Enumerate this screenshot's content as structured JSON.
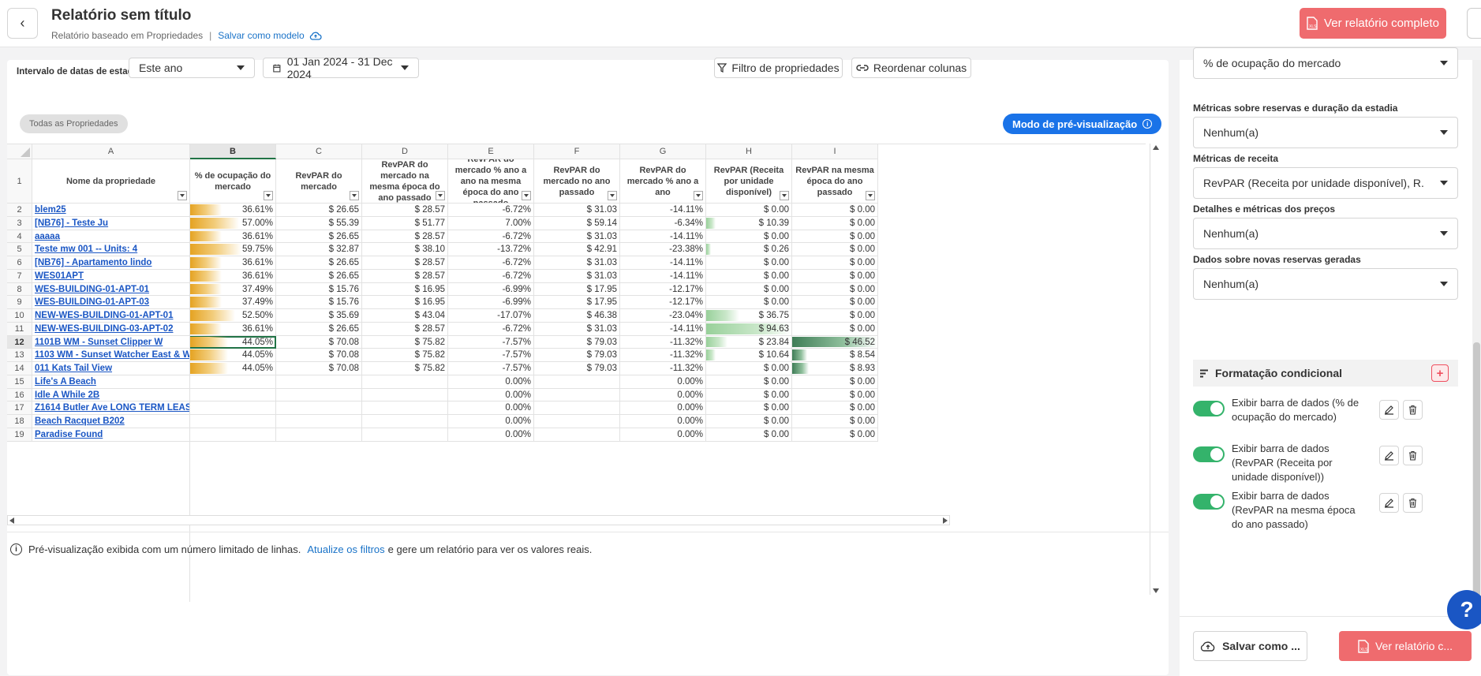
{
  "header": {
    "title": "Relatório sem título",
    "subtitle": "Relatório baseado em Propriedades",
    "separator": "|",
    "save_template": "Salvar como modelo",
    "full_report_button": "Ver relatório completo",
    "icons": {
      "back": "chevron-left-icon",
      "cloud": "cloud-upload-icon",
      "file": "xls-file-icon",
      "help": "help-icon"
    }
  },
  "filters": {
    "date_range_label": "Intervalo de datas de estadia",
    "period_value": "Este ano",
    "date_value": "01 Jan 2024 - 31 Dec 2024",
    "properties_filter_button": "Filtro de propriedades",
    "reorder_columns_button": "Reordenar colunas",
    "all_properties_chip": "Todas as Propriedades",
    "preview_mode_badge": "Modo de pré-visualização"
  },
  "grid": {
    "column_letters": [
      "A",
      "B",
      "C",
      "D",
      "E",
      "F",
      "G",
      "H",
      "I"
    ],
    "selected_column": "B",
    "selected_row": 12,
    "header_row_number": "1",
    "headers": [
      "Nome da propriedade",
      "% de ocupação do mercado",
      "RevPAR do mercado",
      "RevPAR do mercado na mesma época do ano passado",
      "RevPAR do mercado % ano a ano na mesma época do ano passado",
      "RevPAR do mercado no ano passado",
      "RevPAR do mercado % ano a ano",
      "RevPAR (Receita por unidade disponível)",
      "RevPAR na mesma época do ano passado"
    ],
    "rows": [
      {
        "n": "2",
        "name": "blem25",
        "occ": "36.61%",
        "occ_v": 36.61,
        "c": "$ 26.65",
        "d": "$ 28.57",
        "e": "-6.72%",
        "f": "$ 31.03",
        "g": "-14.11%",
        "h": "$ 0.00",
        "h_v": 0,
        "i": "$ 0.00",
        "i_v": 0
      },
      {
        "n": "3",
        "name": "[NB76] - Teste Ju",
        "occ": "57.00%",
        "occ_v": 57.0,
        "c": "$ 55.39",
        "d": "$ 51.77",
        "e": "7.00%",
        "f": "$ 59.14",
        "g": "-6.34%",
        "h": "$ 10.39",
        "h_v": 10.39,
        "i": "$ 0.00",
        "i_v": 0
      },
      {
        "n": "4",
        "name": "aaaaa",
        "occ": "36.61%",
        "occ_v": 36.61,
        "c": "$ 26.65",
        "d": "$ 28.57",
        "e": "-6.72%",
        "f": "$ 31.03",
        "g": "-14.11%",
        "h": "$ 0.00",
        "h_v": 0,
        "i": "$ 0.00",
        "i_v": 0
      },
      {
        "n": "5",
        "name": "Teste mw 001 -- Units: 4",
        "occ": "59.75%",
        "occ_v": 59.75,
        "c": "$ 32.87",
        "d": "$ 38.10",
        "e": "-13.72%",
        "f": "$ 42.91",
        "g": "-23.38%",
        "h": "$ 0.26",
        "h_v": 0.26,
        "i": "$ 0.00",
        "i_v": 0
      },
      {
        "n": "6",
        "name": "[NB76] - Apartamento lindo",
        "occ": "36.61%",
        "occ_v": 36.61,
        "c": "$ 26.65",
        "d": "$ 28.57",
        "e": "-6.72%",
        "f": "$ 31.03",
        "g": "-14.11%",
        "h": "$ 0.00",
        "h_v": 0,
        "i": "$ 0.00",
        "i_v": 0
      },
      {
        "n": "7",
        "name": "WES01APT",
        "occ": "36.61%",
        "occ_v": 36.61,
        "c": "$ 26.65",
        "d": "$ 28.57",
        "e": "-6.72%",
        "f": "$ 31.03",
        "g": "-14.11%",
        "h": "$ 0.00",
        "h_v": 0,
        "i": "$ 0.00",
        "i_v": 0
      },
      {
        "n": "8",
        "name": "WES-BUILDING-01-APT-01",
        "occ": "37.49%",
        "occ_v": 37.49,
        "c": "$ 15.76",
        "d": "$ 16.95",
        "e": "-6.99%",
        "f": "$ 17.95",
        "g": "-12.17%",
        "h": "$ 0.00",
        "h_v": 0,
        "i": "$ 0.00",
        "i_v": 0
      },
      {
        "n": "9",
        "name": "WES-BUILDING-01-APT-03",
        "occ": "37.49%",
        "occ_v": 37.49,
        "c": "$ 15.76",
        "d": "$ 16.95",
        "e": "-6.99%",
        "f": "$ 17.95",
        "g": "-12.17%",
        "h": "$ 0.00",
        "h_v": 0,
        "i": "$ 0.00",
        "i_v": 0
      },
      {
        "n": "10",
        "name": "NEW-WES-BUILDING-01-APT-01",
        "occ": "52.50%",
        "occ_v": 52.5,
        "c": "$ 35.69",
        "d": "$ 43.04",
        "e": "-17.07%",
        "f": "$ 46.38",
        "g": "-23.04%",
        "h": "$ 36.75",
        "h_v": 36.75,
        "i": "$ 0.00",
        "i_v": 0
      },
      {
        "n": "11",
        "name": "NEW-WES-BUILDING-03-APT-02",
        "occ": "36.61%",
        "occ_v": 36.61,
        "c": "$ 26.65",
        "d": "$ 28.57",
        "e": "-6.72%",
        "f": "$ 31.03",
        "g": "-14.11%",
        "h": "$ 94.63",
        "h_v": 94.63,
        "i": "$ 0.00",
        "i_v": 0
      },
      {
        "n": "12",
        "name": "1101B WM - Sunset Clipper W",
        "occ": "44.05%",
        "occ_v": 44.05,
        "c": "$ 70.08",
        "d": "$ 75.82",
        "e": "-7.57%",
        "f": "$ 79.03",
        "g": "-11.32%",
        "h": "$ 23.84",
        "h_v": 23.84,
        "i": "$ 46.52",
        "i_v": 46.52
      },
      {
        "n": "13",
        "name": "1103 WM - Sunset Watcher East & W",
        "occ": "44.05%",
        "occ_v": 44.05,
        "c": "$ 70.08",
        "d": "$ 75.82",
        "e": "-7.57%",
        "f": "$ 79.03",
        "g": "-11.32%",
        "h": "$ 10.64",
        "h_v": 10.64,
        "i": "$ 8.54",
        "i_v": 8.54
      },
      {
        "n": "14",
        "name": "011 Kats Tail View",
        "occ": "44.05%",
        "occ_v": 44.05,
        "c": "$ 70.08",
        "d": "$ 75.82",
        "e": "-7.57%",
        "f": "$ 79.03",
        "g": "-11.32%",
        "h": "$ 0.00",
        "h_v": 0,
        "i": "$ 8.93",
        "i_v": 8.93
      },
      {
        "n": "15",
        "name": "Life's A Beach",
        "occ": "",
        "occ_v": 0,
        "c": "",
        "d": "",
        "e": "0.00%",
        "f": "",
        "g": "0.00%",
        "h": "$ 0.00",
        "h_v": 0,
        "i": "$ 0.00",
        "i_v": 0
      },
      {
        "n": "16",
        "name": "Idle A While 2B",
        "occ": "",
        "occ_v": 0,
        "c": "",
        "d": "",
        "e": "0.00%",
        "f": "",
        "g": "0.00%",
        "h": "$ 0.00",
        "h_v": 0,
        "i": "$ 0.00",
        "i_v": 0
      },
      {
        "n": "17",
        "name": "Z1614 Butler Ave LONG TERM LEAS",
        "occ": "",
        "occ_v": 0,
        "c": "",
        "d": "",
        "e": "0.00%",
        "f": "",
        "g": "0.00%",
        "h": "$ 0.00",
        "h_v": 0,
        "i": "$ 0.00",
        "i_v": 0
      },
      {
        "n": "18",
        "name": "Beach Racquet B202",
        "occ": "",
        "occ_v": 0,
        "c": "",
        "d": "",
        "e": "0.00%",
        "f": "",
        "g": "0.00%",
        "h": "$ 0.00",
        "h_v": 0,
        "i": "$ 0.00",
        "i_v": 0
      },
      {
        "n": "19",
        "name": "Paradise Found",
        "occ": "",
        "occ_v": 0,
        "c": "",
        "d": "",
        "e": "0.00%",
        "f": "",
        "g": "0.00%",
        "h": "$ 0.00",
        "h_v": 0,
        "i": "$ 0.00",
        "i_v": 0
      }
    ]
  },
  "footer": {
    "note_start": "Pré-visualização exibida com um número limitado de linhas.",
    "note_link": "Atualize os filtros",
    "note_end": "e gere um relatório para ver os valores reais."
  },
  "side": {
    "selects": [
      {
        "label": "",
        "value": "% de ocupação do mercado"
      },
      {
        "label": "Métricas sobre reservas e duração da estadia",
        "value": "Nenhum(a)"
      },
      {
        "label": "Métricas de receita",
        "value": "RevPAR (Receita por unidade disponível), R..."
      },
      {
        "label": "Detalhes e métricas dos preços",
        "value": "Nenhum(a)"
      },
      {
        "label": "Dados sobre novas reservas geradas",
        "value": "Nenhum(a)"
      }
    ],
    "conditional_title": "Formatação condicional",
    "rules": [
      {
        "text": "Exibir barra de dados (% de ocupação do mercado)",
        "enabled": true
      },
      {
        "text": "Exibir barra de dados (RevPAR (Receita por unidade disponível))",
        "enabled": true
      },
      {
        "text": "Exibir barra de dados (RevPAR na mesma época do ano passado)",
        "enabled": true
      }
    ],
    "save_as_button": "Salvar como ...",
    "view_report_button": "Ver relatório c..."
  },
  "colors": {
    "accent_red": "#ef6b6e",
    "accent_blue": "#1a73e8",
    "toggle_green": "#34b36b",
    "bar_yellow": "#e5a322",
    "bar_green": "#98d09a",
    "bar_dark_green": "#3f7d57"
  }
}
